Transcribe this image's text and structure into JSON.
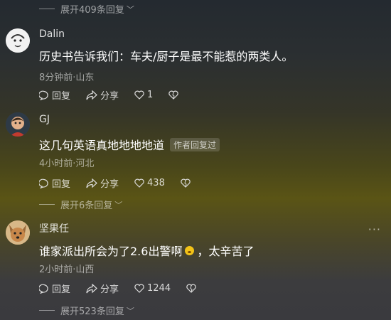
{
  "expand_top": {
    "label": "展开409条回复"
  },
  "comments": [
    {
      "username": "Dalin",
      "text": "历史书告诉我们：车夫/厨子是最不能惹的两类人。",
      "meta": "8分钟前·山东",
      "reply_label": "回复",
      "share_label": "分享",
      "likes": "1"
    },
    {
      "username": "GJ",
      "text": "这几句英语真地地地地道",
      "tag": "作者回复过",
      "meta": "4小时前·河北",
      "reply_label": "回复",
      "share_label": "分享",
      "likes": "438",
      "expand_label": "展开6条回复"
    },
    {
      "username": "坚果任",
      "text_before": "谁家派出所会为了2.6出警啊",
      "text_after": "，太辛苦了",
      "meta": "2小时前·山西",
      "reply_label": "回复",
      "share_label": "分享",
      "likes": "1244",
      "expand_label": "展开523条回复"
    }
  ],
  "colors": {
    "text": "#ffffff",
    "muted": "#9a9a9a"
  }
}
